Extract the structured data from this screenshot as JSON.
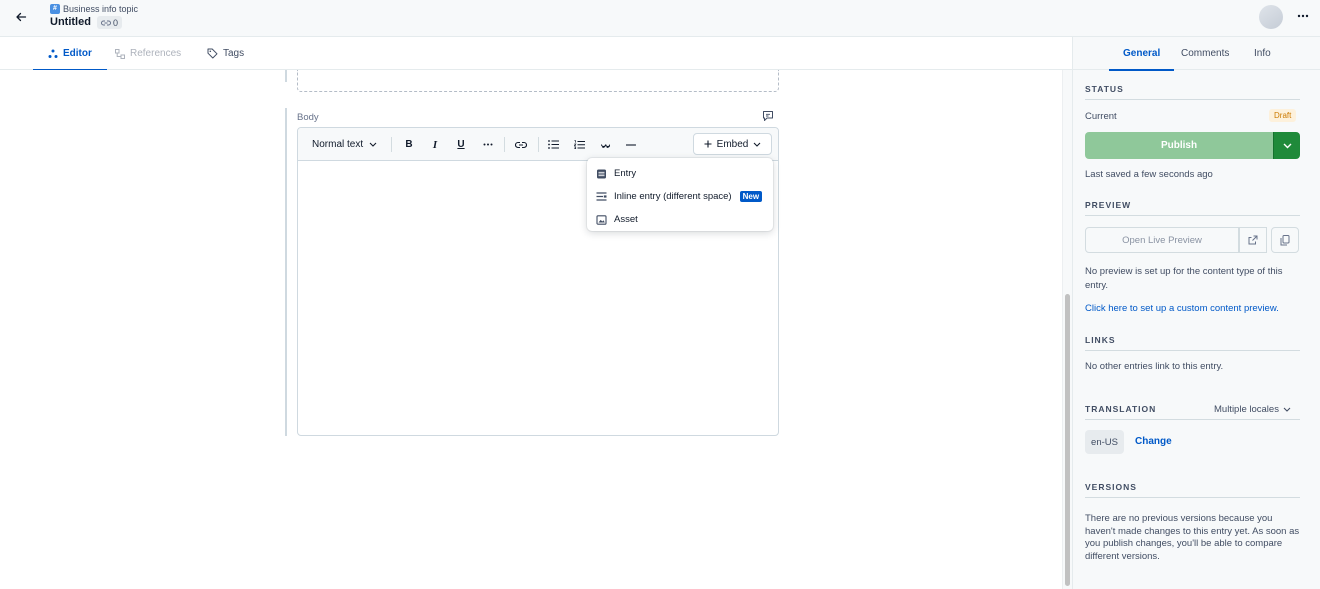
{
  "header": {
    "content_type": "Business info topic",
    "title": "Untitled",
    "links_count": "0"
  },
  "tabs": [
    {
      "label": "Editor",
      "icon": "editor-icon"
    },
    {
      "label": "References",
      "icon": "references-icon"
    },
    {
      "label": "Tags",
      "icon": "tag-icon"
    }
  ],
  "body_field": {
    "label": "Body",
    "toolbar": {
      "text_style": "Normal text",
      "bold": "B",
      "italic": "I",
      "underline": "U",
      "embed_label": "Embed"
    },
    "embed_menu": [
      {
        "label": "Entry",
        "icon": "entry-icon"
      },
      {
        "label": "Inline entry (different space)",
        "icon": "inline-entry-icon",
        "badge": "New"
      },
      {
        "label": "Asset",
        "icon": "asset-icon"
      }
    ]
  },
  "sidebar": {
    "tabs": [
      "General",
      "Comments",
      "Info"
    ],
    "status": {
      "heading": "STATUS",
      "current_label": "Current",
      "badge": "Draft",
      "publish_label": "Publish",
      "saved_text": "Last saved a few seconds ago"
    },
    "preview": {
      "heading": "PREVIEW",
      "button_label": "Open Live Preview",
      "note": "No preview is set up for the content type of this entry.",
      "setup_link": "Click here to set up a custom content preview."
    },
    "links": {
      "heading": "LINKS",
      "text": "No other entries link to this entry."
    },
    "translation": {
      "heading": "TRANSLATION",
      "dropdown": "Multiple locales",
      "locale": "en-US",
      "change_label": "Change"
    },
    "versions": {
      "heading": "VERSIONS",
      "text": "There are no previous versions because you haven't made changes to this entry yet. As soon as you publish changes, you'll be able to compare different versions."
    }
  },
  "colors": {
    "accent": "#0059c8",
    "publish": "#8fc89a",
    "publish_dark": "#1f8a3a",
    "draft_badge_bg": "#fdf1dc",
    "draft_badge_text": "#cc7a00"
  }
}
